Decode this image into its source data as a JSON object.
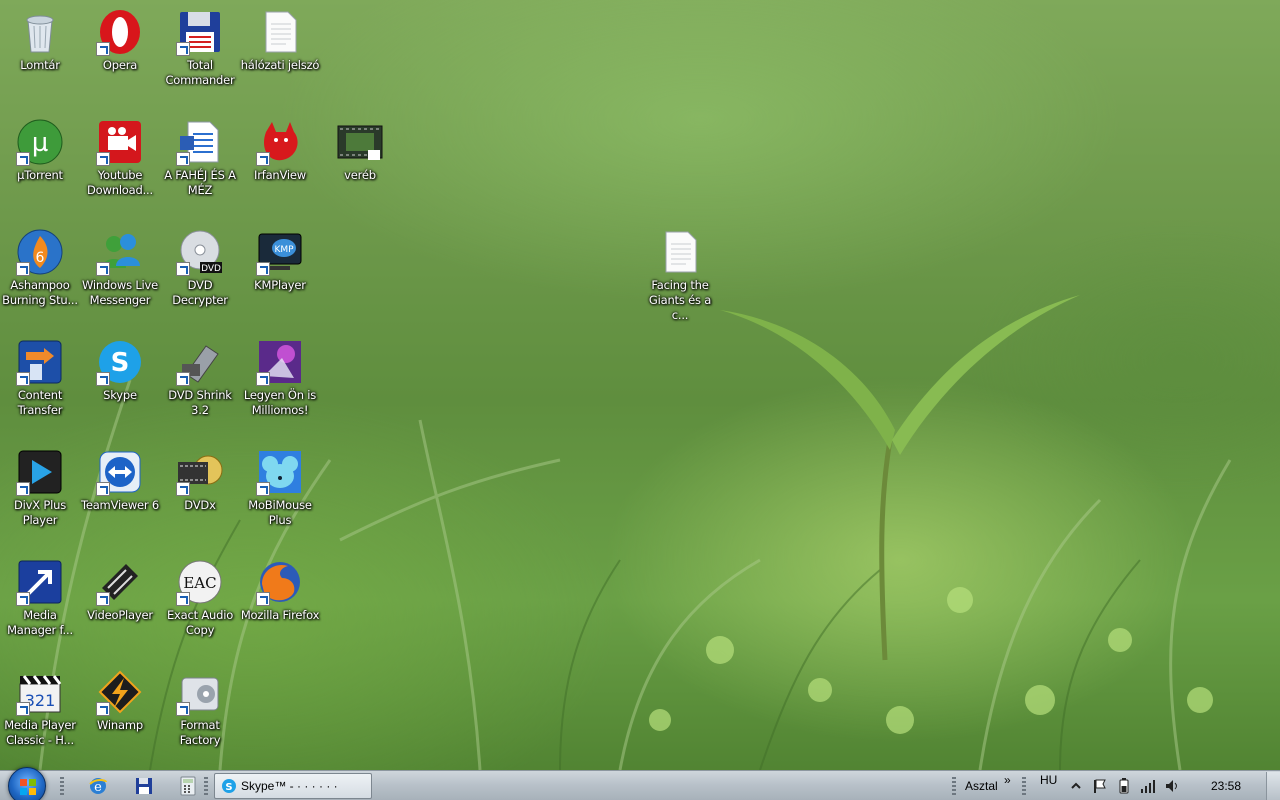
{
  "desktop": {
    "icons": [
      {
        "label": "Lomtár",
        "icon": "recycle-bin-icon"
      },
      {
        "label": "Opera",
        "icon": "opera-icon"
      },
      {
        "label": "Total\nCommander",
        "icon": "floppy-disk-icon"
      },
      {
        "label": "hálózati jelszó",
        "icon": "text-document-icon"
      },
      {
        "label": "µTorrent",
        "icon": "utorrent-icon"
      },
      {
        "label": "Youtube\nDownload...",
        "icon": "video-camera-icon"
      },
      {
        "label": "A FAHÉJ ÉS A\nMÉZ",
        "icon": "word-document-icon"
      },
      {
        "label": "IrfanView",
        "icon": "red-cat-icon"
      },
      {
        "label": "veréb",
        "icon": "video-file-icon"
      },
      {
        "label": "Ashampoo\nBurning Stu...",
        "icon": "ashampoo-flame-icon"
      },
      {
        "label": "Windows Live\nMessenger",
        "icon": "messenger-buddies-icon"
      },
      {
        "label": "DVD\nDecrypter",
        "icon": "dvd-disc-icon"
      },
      {
        "label": "KMPlayer",
        "icon": "kmp-monitor-icon"
      },
      {
        "label": "Facing the\nGiants és a c...",
        "icon": "text-document-icon"
      },
      {
        "label": "Content\nTransfer",
        "icon": "content-transfer-icon"
      },
      {
        "label": "Skype",
        "icon": "skype-icon"
      },
      {
        "label": "DVD Shrink\n3.2",
        "icon": "dvd-shrink-icon"
      },
      {
        "label": "Legyen Ön is\nMilliomos!",
        "icon": "millionaire-game-icon"
      },
      {
        "label": "DivX Plus\nPlayer",
        "icon": "play-button-icon"
      },
      {
        "label": "TeamViewer 6",
        "icon": "teamviewer-icon"
      },
      {
        "label": "DVDx",
        "icon": "film-reel-icon"
      },
      {
        "label": "MoBiMouse\nPlus",
        "icon": "mouse-character-icon"
      },
      {
        "label": "Media\nManager f...",
        "icon": "media-manager-icon"
      },
      {
        "label": "VideoPlayer",
        "icon": "film-strip-icon"
      },
      {
        "label": "Exact Audio\nCopy",
        "icon": "eac-disc-icon"
      },
      {
        "label": "Mozilla Firefox",
        "icon": "firefox-icon"
      },
      {
        "label": "Media Player\nClassic - H...",
        "icon": "clapperboard-icon"
      },
      {
        "label": "Winamp",
        "icon": "winamp-bolt-icon"
      },
      {
        "label": "Format\nFactory",
        "icon": "format-factory-icon"
      }
    ]
  },
  "taskbar": {
    "quicklaunch": [
      "ie-icon",
      "save-icon",
      "calculator-icon"
    ],
    "active_task": {
      "label": "Skype™ - ·  ·  ·  ·  ·  ·",
      "icon": "skype-icon"
    },
    "toolbar_label": "Asztal",
    "toolbar_chevron": "»",
    "language": "HU",
    "tray_icons": [
      "show-hidden-icons-icon",
      "action-center-flag-icon",
      "battery-icon",
      "network-signal-icon",
      "volume-icon"
    ],
    "clock": "23:58"
  },
  "colors": {
    "taskbar_top": "#cfd6dc",
    "taskbar_bottom": "#a7b1ba",
    "label_text": "#ffffff",
    "grass": "#6f9a4c"
  }
}
